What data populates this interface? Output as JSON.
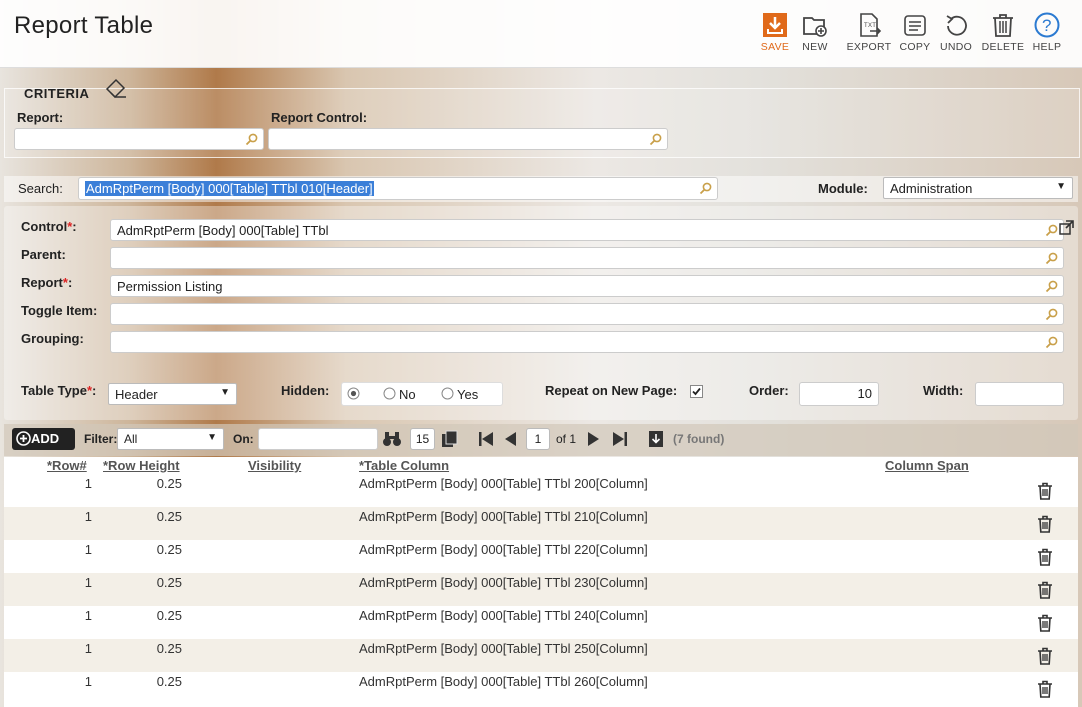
{
  "header": {
    "title": "Report Table",
    "toolbar": [
      {
        "label": "SAVE",
        "icon": "save-icon"
      },
      {
        "label": "NEW",
        "icon": "new-folder-icon"
      },
      {
        "label": "EXPORT",
        "icon": "export-icon"
      },
      {
        "label": "COPY",
        "icon": "copy-icon"
      },
      {
        "label": "UNDO",
        "icon": "undo-icon"
      },
      {
        "label": "DELETE",
        "icon": "delete-icon"
      },
      {
        "label": "HELP",
        "icon": "help-icon"
      }
    ]
  },
  "criteria": {
    "legend": "CRITERIA",
    "report_label": "Report:",
    "report_value": "",
    "control_label": "Report Control:",
    "control_value": ""
  },
  "search": {
    "label": "Search:",
    "value": "AdmRptPerm [Body] 000[Table] TTbl 010[Header]",
    "module_label": "Module:",
    "module_value": "Administration"
  },
  "form": {
    "control_label": "Control",
    "control_value": "AdmRptPerm [Body] 000[Table] TTbl",
    "parent_label": "Parent:",
    "parent_value": "",
    "report_label": "Report",
    "report_value": "Permission Listing",
    "toggle_label": "Toggle Item:",
    "toggle_value": "",
    "grouping_label": "Grouping:",
    "grouping_value": "",
    "table_type_label": "Table Type",
    "table_type_value": "Header",
    "hidden_label": "Hidden:",
    "hidden_no": "No",
    "hidden_yes": "Yes",
    "repeat_label": "Repeat on New Page:",
    "repeat_checked": true,
    "order_label": "Order:",
    "order_value": "10",
    "width_label": "Width:",
    "width_value": "",
    "required_mark": "*",
    "colon": ":"
  },
  "grid_toolbar": {
    "add_label": "ADD",
    "filter_label": "Filter:",
    "filter_value": "All",
    "on_label": "On:",
    "on_value": "",
    "page_size": "15",
    "page": "1",
    "of_label": "of 1",
    "found": "(7 found)"
  },
  "table": {
    "headers": [
      "*Row#",
      "*Row Height",
      "Visibility",
      "*Table Column",
      "Column Span"
    ],
    "rows": [
      {
        "row": "1",
        "height": "0.25",
        "visibility": "",
        "column": "AdmRptPerm [Body] 000[Table] TTbl 200[Column]",
        "span": ""
      },
      {
        "row": "1",
        "height": "0.25",
        "visibility": "",
        "column": "AdmRptPerm [Body] 000[Table] TTbl 210[Column]",
        "span": ""
      },
      {
        "row": "1",
        "height": "0.25",
        "visibility": "",
        "column": "AdmRptPerm [Body] 000[Table] TTbl 220[Column]",
        "span": ""
      },
      {
        "row": "1",
        "height": "0.25",
        "visibility": "",
        "column": "AdmRptPerm [Body] 000[Table] TTbl 230[Column]",
        "span": ""
      },
      {
        "row": "1",
        "height": "0.25",
        "visibility": "",
        "column": "AdmRptPerm [Body] 000[Table] TTbl 240[Column]",
        "span": ""
      },
      {
        "row": "1",
        "height": "0.25",
        "visibility": "",
        "column": "AdmRptPerm [Body] 000[Table] TTbl 250[Column]",
        "span": ""
      },
      {
        "row": "1",
        "height": "0.25",
        "visibility": "",
        "column": "AdmRptPerm [Body] 000[Table] TTbl 260[Column]",
        "span": ""
      }
    ]
  },
  "colors": {
    "accent": "#e06a1a",
    "link": "#2b7ad1",
    "selection": "#3b7fd8"
  }
}
